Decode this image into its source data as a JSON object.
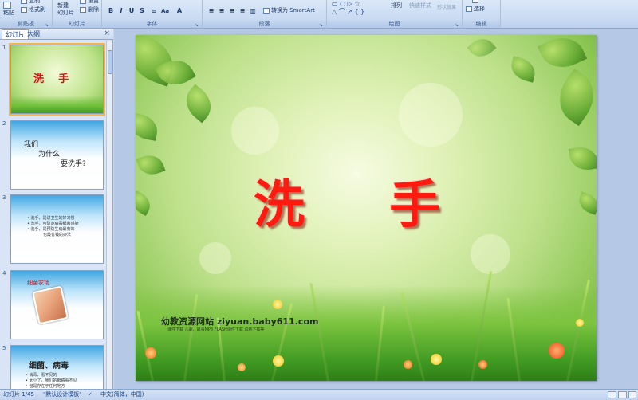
{
  "ribbon": {
    "groups": {
      "clipboard": "剪贴板",
      "slides": "幻灯片",
      "font": "字体",
      "paragraph": "段落",
      "drawing": "绘图",
      "editing": "编辑"
    },
    "buttons": {
      "paste": "粘贴",
      "copy": "复制",
      "format_painter": "格式刷",
      "new_slide_line1": "新建",
      "new_slide_line2": "幻灯片",
      "reset": "重置",
      "delete": "删除",
      "convert_smartart": "转换为 SmartArt",
      "arrange": "排列",
      "quick_styles": "快速样式",
      "shape_effects": "形状效果",
      "select": "选择"
    },
    "format_buttons": [
      "B",
      "I",
      "U",
      "S",
      "A"
    ]
  },
  "left_panel": {
    "tabs": [
      "幻灯片",
      "大纲"
    ],
    "close": "×",
    "thumbnails": [
      {
        "number": "1",
        "title": "洗    手"
      },
      {
        "number": "2",
        "line1": "我们",
        "line2": "为什么",
        "line3": "要洗手?"
      },
      {
        "number": "3",
        "bullets": [
          "洗手，是讲卫生的好习惯",
          "洗手，可防范病毒细菌感染",
          "洗手，是预防生病最有效",
          "也最省钱的办法"
        ]
      },
      {
        "number": "4",
        "title": "细菌农场"
      },
      {
        "number": "5",
        "title": "细菌、病毒",
        "bullets": [
          "病毒，看不见的",
          "太小了，我们的眼睛看不见",
          "但是存在于任何地方"
        ]
      }
    ]
  },
  "slide": {
    "title_char1": "洗",
    "title_char2": "手",
    "site_line": "幼教资源网站  ziyuan.baby611.com",
    "sub_line": "课件下载    儿歌、故事MP3    FLASH课件下载    试卷下载等"
  },
  "statusbar": {
    "slide_info": "幻灯片 1/45",
    "theme": "\"默认设计模板\"",
    "language": "中文(简体，中国)"
  }
}
